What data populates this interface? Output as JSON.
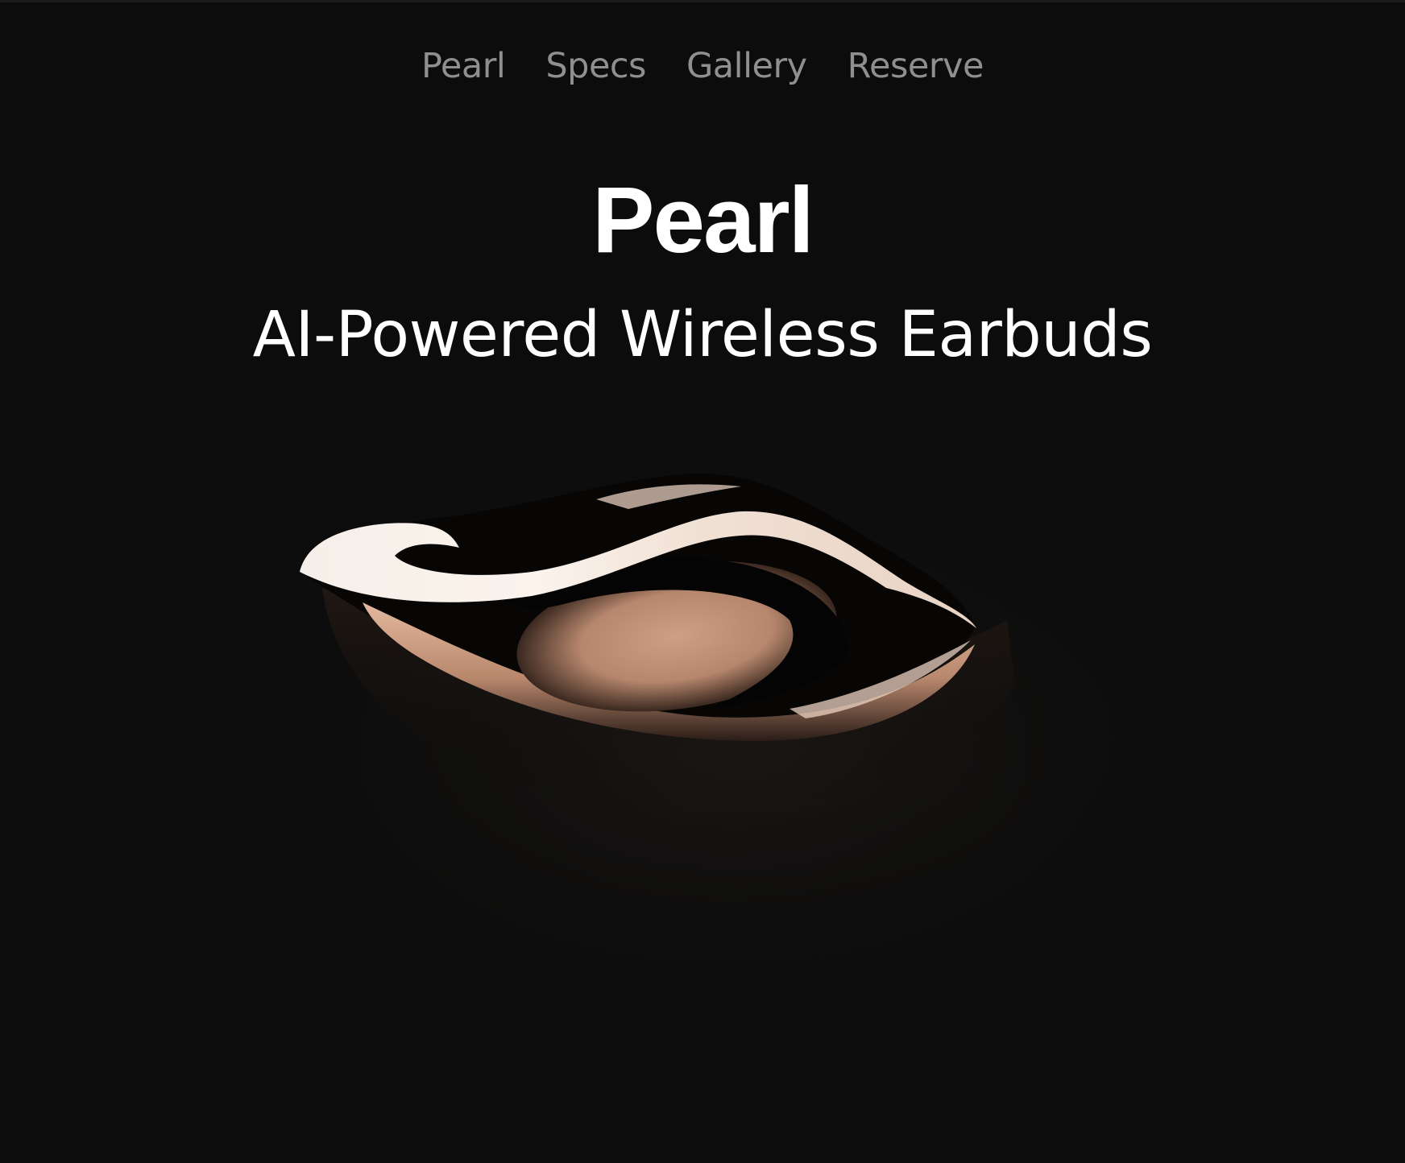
{
  "nav": {
    "items": [
      {
        "label": "Pearl"
      },
      {
        "label": "Specs"
      },
      {
        "label": "Gallery"
      },
      {
        "label": "Reserve"
      }
    ]
  },
  "hero": {
    "title": "Pearl",
    "subtitle": "AI-Powered Wireless Earbuds",
    "image_icon": "earbud-product-render"
  },
  "colors": {
    "background": "#0c0c0c",
    "nav_text": "#8f8f8f",
    "heading_text": "#ffffff",
    "product_highlight": "#f3dccd",
    "product_tone": "#c99a7e"
  }
}
